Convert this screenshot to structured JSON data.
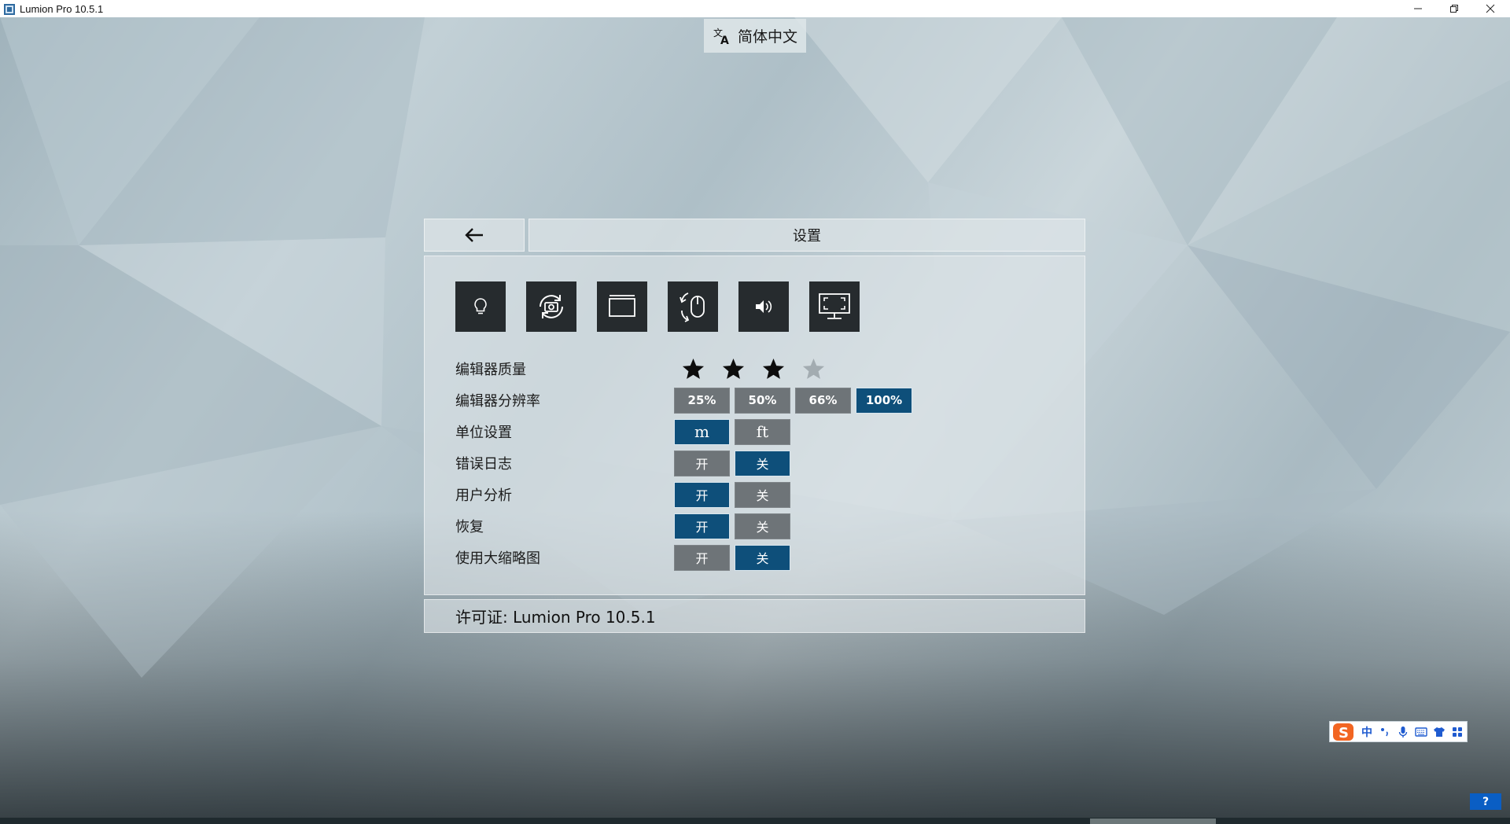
{
  "window": {
    "title": "Lumion Pro 10.5.1",
    "controls": [
      "minimize",
      "restore",
      "close"
    ]
  },
  "language_button": {
    "icon": "translate-icon",
    "label": "简体中文"
  },
  "settings": {
    "back_icon": "arrow-left-icon",
    "title": "设置",
    "tabs": [
      {
        "icon": "lightbulb-icon"
      },
      {
        "icon": "camera-rotate-icon"
      },
      {
        "icon": "window-icon"
      },
      {
        "icon": "mouse-rotate-icon"
      },
      {
        "icon": "speaker-icon"
      },
      {
        "icon": "fullscreen-monitor-icon"
      }
    ],
    "rows": {
      "editor_quality": {
        "label": "编辑器质量",
        "stars_filled": 3,
        "stars_total": 4
      },
      "editor_resolution": {
        "label": "编辑器分辨率",
        "options": [
          "25%",
          "50%",
          "66%",
          "100%"
        ],
        "selected": "100%"
      },
      "units": {
        "label": "单位设置",
        "options": [
          "m",
          "ft"
        ],
        "selected": "m"
      },
      "error_log": {
        "label": "错误日志",
        "options": [
          "开",
          "关"
        ],
        "selected": "关"
      },
      "user_analytics": {
        "label": "用户分析",
        "options": [
          "开",
          "关"
        ],
        "selected": "开"
      },
      "recovery": {
        "label": "恢复",
        "options": [
          "开",
          "关"
        ],
        "selected": "开"
      },
      "large_thumbnails": {
        "label": "使用大缩略图",
        "options": [
          "开",
          "关"
        ],
        "selected": "关"
      }
    },
    "license": "许可证: Lumion Pro 10.5.1"
  },
  "ime_toolbar": {
    "logo": "sogou-logo",
    "mode": "中",
    "icons": [
      "punctuation-icon",
      "microphone-icon",
      "keyboard-icon",
      "skin-shirt-icon",
      "toolbox-grid-icon"
    ]
  },
  "help_button": {
    "label": "?"
  },
  "colors": {
    "selected": "#0e4f7a",
    "unselected": "#6e7478",
    "tab_bg": "#262b2e",
    "help_blue": "#0a5ec4"
  }
}
